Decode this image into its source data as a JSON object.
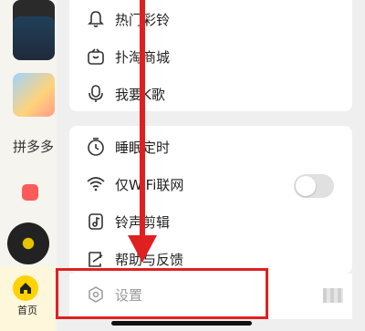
{
  "background": {
    "section_title": "拼多多",
    "home_tab_label": "首页"
  },
  "menu": {
    "group1": [
      {
        "label": "热门彩铃",
        "icon": "bell-icon"
      },
      {
        "label": "扑淘商城",
        "icon": "shopping-bag-icon"
      },
      {
        "label": "我要K歌",
        "icon": "microphone-icon"
      }
    ],
    "group2": [
      {
        "label": "睡眠定时",
        "icon": "timer-icon"
      },
      {
        "label": "仅WiFi联网",
        "icon": "wifi-icon",
        "toggle_on": false
      },
      {
        "label": "铃声剪辑",
        "icon": "music-note-icon"
      },
      {
        "label": "帮助与反馈",
        "icon": "feedback-icon"
      }
    ],
    "settings": {
      "label": "设置",
      "icon": "settings-icon"
    }
  },
  "colors": {
    "highlight": "#e02020",
    "accent": "#ffd200"
  }
}
